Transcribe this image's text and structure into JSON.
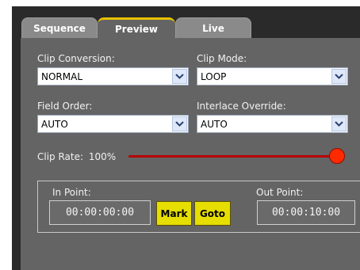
{
  "tabs": [
    {
      "label": "Sequence"
    },
    {
      "label": "Preview"
    },
    {
      "label": "Live"
    }
  ],
  "clip_conversion": {
    "label": "Clip Conversion:",
    "value": "NORMAL"
  },
  "clip_mode": {
    "label": "Clip Mode:",
    "value": "LOOP"
  },
  "field_order": {
    "label": "Field Order:",
    "value": "AUTO"
  },
  "interlace_override": {
    "label": "Interlace Override:",
    "value": "AUTO"
  },
  "clip_rate": {
    "label": "Clip Rate:",
    "value": "100%",
    "slider_level": 1.0
  },
  "in_point": {
    "label": "In Point:",
    "value": "00:00:00:00"
  },
  "out_point": {
    "label": "Out Point:",
    "value": "00:00:10:00"
  },
  "buttons": {
    "mark": "Mark",
    "goto": "Goto"
  },
  "colors": {
    "accent": "#e8c200",
    "slider": "#ff2a00",
    "button": "#e6de00"
  }
}
